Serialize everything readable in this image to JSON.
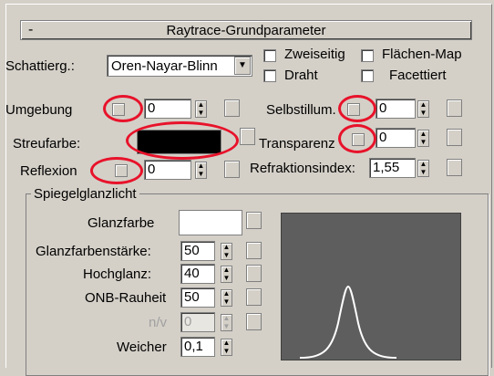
{
  "panel": {
    "title": "Raytrace-Grundparameter",
    "collapse_symbol": "-"
  },
  "shading": {
    "label": "Schattierg.:",
    "value": "Oren-Nayar-Blinn"
  },
  "checkboxes": {
    "two_sided": "Zweiseitig",
    "wire": "Draht",
    "face_map": "Flächen-Map",
    "faceted": "Facettiert"
  },
  "params": {
    "ambient": {
      "label": "Umgebung",
      "value": "0"
    },
    "self_illum": {
      "label": "Selbstillum.",
      "value": "0"
    },
    "diffuse": {
      "label": "Streufarbe:"
    },
    "transparency": {
      "label": "Transparenz",
      "value": "0"
    },
    "reflection": {
      "label": "Reflexion",
      "value": "0"
    },
    "ior": {
      "label": "Refraktionsindex:",
      "value": "1,55"
    }
  },
  "specular": {
    "group_label": "Spiegelglanzlicht",
    "color_label": "Glanzfarbe",
    "level_label": "Glanzfarbenstärke:",
    "level_value": "50",
    "gloss_label": "Hochglanz:",
    "gloss_value": "40",
    "onb_label": "ONB-Rauheit",
    "onb_value": "50",
    "nv_label": "n/v",
    "nv_value": "0",
    "soften_label": "Weicher",
    "soften_value": "0,1"
  },
  "colors": {
    "highlight_ring": "#e8122a",
    "diffuse_swatch": "#000000",
    "specular_swatch": "#ffffff",
    "graph_bg": "#5e5e5e",
    "graph_curve": "#ffffff"
  },
  "icons": {
    "spinner": "spinner-up-down-icon",
    "dropdown": "chevron-down-icon",
    "map_button": "map-slot-icon"
  }
}
